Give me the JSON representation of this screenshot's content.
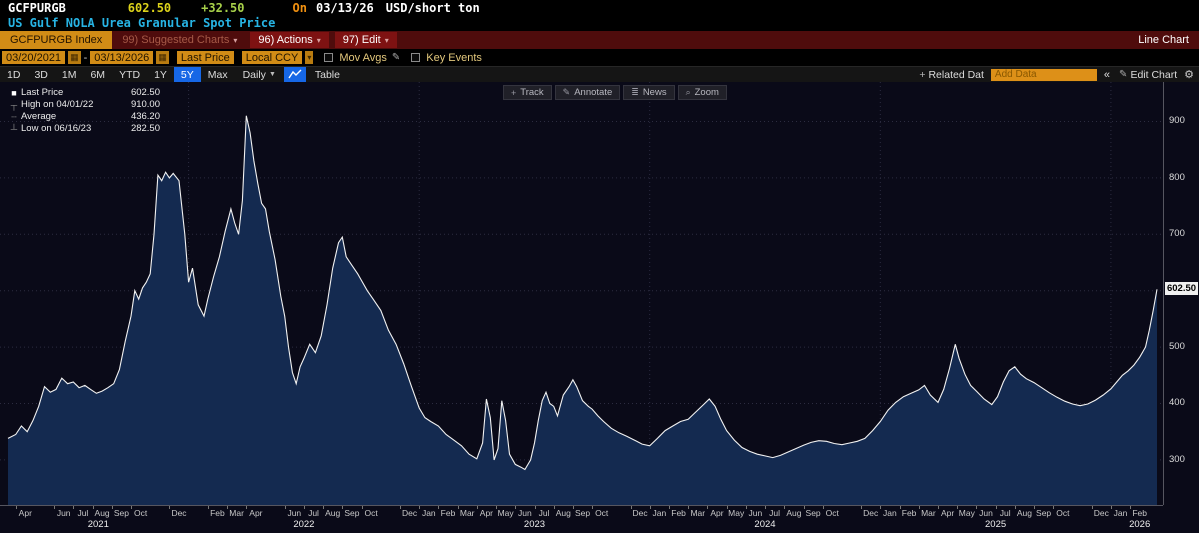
{
  "header": {
    "ticker": "GCFPURGB",
    "last": "602.50",
    "change": "+32.50",
    "on_label": "On",
    "date": "03/13/26",
    "unit": "USD/short ton",
    "description": "US Gulf NOLA Urea Granular Spot Price"
  },
  "menu_bar": {
    "ticker_tab": "GCFPURGB Index",
    "suggested_charts": "99) Suggested Charts",
    "actions": "96) Actions",
    "edit": "97) Edit",
    "chart_type": "Line Chart"
  },
  "toolbar": {
    "date_from": "03/20/2021",
    "date_to": "03/13/2026",
    "price_field": "Last Price",
    "currency": "Local CCY",
    "mov_avgs": "Mov Avgs",
    "key_events": "Key Events"
  },
  "period_bar": {
    "periods": [
      "1D",
      "3D",
      "1M",
      "6M",
      "YTD",
      "1Y",
      "5Y",
      "Max"
    ],
    "active_period": "5Y",
    "frequency": "Daily",
    "table": "Table",
    "related_data": "Related Dat",
    "add_data_placeholder": "Add Data",
    "collapse": "«",
    "edit_chart": "Edit Chart"
  },
  "chart_tools": [
    "Track",
    "Annotate",
    "News",
    "Zoom"
  ],
  "chart_tool_icons": [
    "+",
    "✎",
    "≣",
    "⌕"
  ],
  "legend": {
    "last_price_label": "Last Price",
    "last_price": "602.50",
    "high_label": "High on 04/01/22",
    "high": "910.00",
    "avg_label": "Average",
    "avg": "436.20",
    "low_label": "Low on 06/16/23",
    "low": "282.50"
  },
  "glyphs": {
    "calendar": "▦",
    "pencil": "✎",
    "gear": "⚙",
    "chevron": "▾",
    "dropdown": "▼",
    "plus": "+",
    "collapse": "«",
    "square": "■",
    "high_marker": "┬",
    "avg_marker": "┄",
    "low_marker": "┴"
  },
  "colors": {
    "line": "#f2f2f2",
    "area_fill": "#142a50",
    "grid": "#2c2c40",
    "chart_bg": "#0a0a18",
    "amber": "#d18c16",
    "active_blue": "#1667e6"
  },
  "chart_data": {
    "type": "area",
    "title": "US Gulf NOLA Urea Granular Spot Price (GCFPURGB Index)",
    "xlabel": "",
    "ylabel": "USD/short ton",
    "ylim": [
      220,
      970
    ],
    "yticks": [
      300,
      400,
      500,
      600,
      700,
      800,
      900
    ],
    "x_domain_months": [
      2.6,
      62.4
    ],
    "x_domain_note": "x = months since Jan 2021; domain 03/20/2021 to 03/13/2026",
    "last_value": 602.5,
    "last_label": "602.50",
    "high": {
      "date": "04/01/22",
      "value": 910.0
    },
    "low": {
      "date": "06/16/23",
      "value": 282.5
    },
    "average": 436.2,
    "x": [
      2.6,
      3.0,
      3.3,
      3.6,
      3.9,
      4.2,
      4.5,
      4.8,
      5.1,
      5.4,
      5.7,
      6.0,
      6.3,
      6.6,
      6.9,
      7.2,
      7.5,
      7.8,
      8.1,
      8.4,
      8.7,
      9.0,
      9.2,
      9.4,
      9.6,
      9.8,
      10.0,
      10.2,
      10.4,
      10.6,
      10.8,
      11.0,
      11.2,
      11.5,
      11.8,
      12.0,
      12.2,
      12.5,
      12.8,
      13.0,
      13.3,
      13.6,
      13.9,
      14.2,
      14.4,
      14.6,
      14.8,
      15.0,
      15.2,
      15.4,
      15.6,
      15.8,
      16.0,
      16.2,
      16.5,
      16.8,
      17.0,
      17.2,
      17.4,
      17.6,
      17.8,
      18.0,
      18.3,
      18.6,
      18.9,
      19.2,
      19.5,
      19.8,
      20.0,
      20.2,
      20.5,
      20.8,
      21.0,
      21.3,
      21.6,
      22.0,
      22.4,
      22.8,
      23.2,
      23.6,
      24.0,
      24.3,
      24.6,
      25.0,
      25.4,
      25.8,
      26.2,
      26.6,
      27.0,
      27.3,
      27.5,
      27.7,
      27.9,
      28.1,
      28.3,
      28.5,
      28.7,
      29.0,
      29.3,
      29.5,
      29.8,
      30.0,
      30.2,
      30.4,
      30.6,
      30.8,
      31.0,
      31.2,
      31.5,
      31.8,
      32.0,
      32.2,
      32.5,
      32.8,
      33.0,
      33.3,
      33.6,
      34.0,
      34.4,
      34.8,
      35.2,
      35.6,
      36.0,
      36.4,
      36.8,
      37.2,
      37.6,
      38.0,
      38.4,
      38.8,
      39.1,
      39.4,
      39.7,
      40.0,
      40.4,
      40.8,
      41.2,
      41.6,
      42.0,
      42.4,
      42.8,
      43.2,
      43.6,
      44.0,
      44.4,
      44.8,
      45.2,
      45.6,
      46.0,
      46.4,
      46.8,
      47.2,
      47.6,
      48.0,
      48.4,
      48.8,
      49.2,
      49.6,
      50.0,
      50.3,
      50.6,
      51.0,
      51.3,
      51.6,
      51.9,
      52.1,
      52.4,
      52.7,
      53.0,
      53.4,
      53.8,
      54.1,
      54.4,
      54.7,
      55.0,
      55.3,
      55.6,
      56.0,
      56.4,
      56.8,
      57.2,
      57.6,
      58.0,
      58.4,
      58.8,
      59.2,
      59.6,
      60.0,
      60.3,
      60.6,
      60.9,
      61.2,
      61.5,
      61.8,
      62.0,
      62.2,
      62.4
    ],
    "values": [
      338,
      345,
      360,
      350,
      370,
      395,
      430,
      420,
      425,
      445,
      435,
      438,
      428,
      432,
      425,
      418,
      422,
      428,
      435,
      460,
      510,
      555,
      600,
      585,
      605,
      615,
      630,
      700,
      805,
      795,
      810,
      800,
      808,
      795,
      700,
      615,
      640,
      575,
      555,
      585,
      625,
      660,
      705,
      745,
      720,
      700,
      760,
      910,
      880,
      830,
      790,
      755,
      745,
      705,
      655,
      590,
      555,
      500,
      455,
      435,
      465,
      480,
      505,
      490,
      520,
      575,
      640,
      685,
      695,
      660,
      645,
      630,
      618,
      600,
      585,
      565,
      530,
      505,
      470,
      430,
      392,
      375,
      368,
      360,
      345,
      335,
      325,
      310,
      302,
      330,
      408,
      375,
      300,
      320,
      405,
      370,
      310,
      292,
      287,
      283,
      300,
      330,
      370,
      405,
      420,
      400,
      395,
      378,
      415,
      430,
      442,
      430,
      405,
      395,
      390,
      378,
      368,
      356,
      348,
      342,
      335,
      328,
      325,
      338,
      352,
      360,
      368,
      372,
      385,
      398,
      408,
      395,
      372,
      352,
      335,
      322,
      315,
      310,
      307,
      304,
      308,
      314,
      320,
      326,
      331,
      334,
      333,
      329,
      327,
      330,
      333,
      338,
      352,
      368,
      388,
      402,
      412,
      418,
      424,
      432,
      415,
      402,
      425,
      462,
      505,
      480,
      452,
      432,
      422,
      408,
      398,
      412,
      438,
      458,
      465,
      452,
      444,
      437,
      428,
      419,
      411,
      404,
      399,
      396,
      399,
      406,
      415,
      426,
      438,
      450,
      458,
      468,
      482,
      500,
      530,
      565,
      602.5
    ],
    "month_ticks": [
      {
        "m": 3,
        "l": "Apr"
      },
      {
        "m": 5,
        "l": "Jun"
      },
      {
        "m": 6,
        "l": "Jul"
      },
      {
        "m": 7,
        "l": "Aug"
      },
      {
        "m": 8,
        "l": "Sep"
      },
      {
        "m": 9,
        "l": "Oct"
      },
      {
        "m": 11,
        "l": "Dec"
      },
      {
        "m": 13,
        "l": "Feb"
      },
      {
        "m": 14,
        "l": "Mar"
      },
      {
        "m": 15,
        "l": "Apr"
      },
      {
        "m": 17,
        "l": "Jun"
      },
      {
        "m": 18,
        "l": "Jul"
      },
      {
        "m": 19,
        "l": "Aug"
      },
      {
        "m": 20,
        "l": "Sep"
      },
      {
        "m": 21,
        "l": "Oct"
      },
      {
        "m": 23,
        "l": "Dec"
      },
      {
        "m": 24,
        "l": "Jan"
      },
      {
        "m": 25,
        "l": "Feb"
      },
      {
        "m": 26,
        "l": "Mar"
      },
      {
        "m": 27,
        "l": "Apr"
      },
      {
        "m": 28,
        "l": "May"
      },
      {
        "m": 29,
        "l": "Jun"
      },
      {
        "m": 30,
        "l": "Jul"
      },
      {
        "m": 31,
        "l": "Aug"
      },
      {
        "m": 32,
        "l": "Sep"
      },
      {
        "m": 33,
        "l": "Oct"
      },
      {
        "m": 35,
        "l": "Dec"
      },
      {
        "m": 36,
        "l": "Jan"
      },
      {
        "m": 37,
        "l": "Feb"
      },
      {
        "m": 38,
        "l": "Mar"
      },
      {
        "m": 39,
        "l": "Apr"
      },
      {
        "m": 40,
        "l": "May"
      },
      {
        "m": 41,
        "l": "Jun"
      },
      {
        "m": 42,
        "l": "Jul"
      },
      {
        "m": 43,
        "l": "Aug"
      },
      {
        "m": 44,
        "l": "Sep"
      },
      {
        "m": 45,
        "l": "Oct"
      },
      {
        "m": 47,
        "l": "Dec"
      },
      {
        "m": 48,
        "l": "Jan"
      },
      {
        "m": 49,
        "l": "Feb"
      },
      {
        "m": 50,
        "l": "Mar"
      },
      {
        "m": 51,
        "l": "Apr"
      },
      {
        "m": 52,
        "l": "May"
      },
      {
        "m": 53,
        "l": "Jun"
      },
      {
        "m": 54,
        "l": "Jul"
      },
      {
        "m": 55,
        "l": "Aug"
      },
      {
        "m": 56,
        "l": "Sep"
      },
      {
        "m": 57,
        "l": "Oct"
      },
      {
        "m": 59,
        "l": "Dec"
      },
      {
        "m": 60,
        "l": "Jan"
      },
      {
        "m": 61,
        "l": "Feb"
      }
    ],
    "year_ticks": [
      {
        "m": 7.3,
        "l": "2021"
      },
      {
        "m": 18,
        "l": "2022"
      },
      {
        "m": 30,
        "l": "2023"
      },
      {
        "m": 42,
        "l": "2024"
      },
      {
        "m": 54,
        "l": "2025"
      },
      {
        "m": 61.5,
        "l": "2026"
      }
    ],
    "year_gridlines": [
      12,
      24,
      36,
      48,
      60
    ]
  }
}
